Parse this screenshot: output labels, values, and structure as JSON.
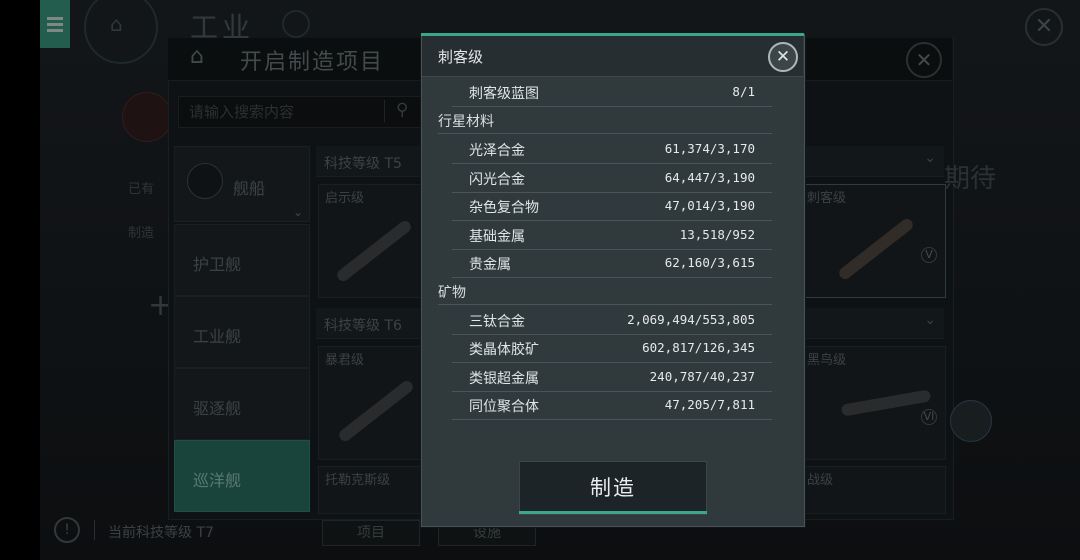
{
  "background": {
    "top_title": "工业",
    "side_labels": [
      "已有",
      "制造"
    ],
    "status_text": "当前科技等级 T7"
  },
  "mfg_dialog": {
    "title": "开启制造项目",
    "search_placeholder": "请输入搜索内容",
    "category_selected": "舰船",
    "categories": [
      "护卫舰",
      "工业舰",
      "驱逐舰",
      "巡洋舰"
    ],
    "tiers": [
      {
        "label": "科技等级 T5",
        "ships": [
          "启示级",
          "刺客级"
        ],
        "right_text": "期待"
      },
      {
        "label": "科技等级 T6",
        "ships": [
          "暴君级",
          "黑鸟级"
        ]
      },
      {
        "label": "",
        "ships": [
          "托勒克斯级",
          "战级"
        ]
      }
    ],
    "level_badges": [
      "V",
      "VI"
    ],
    "bottom_tabs": [
      "项目",
      "设施"
    ]
  },
  "popup": {
    "title": "刺客级",
    "blueprint": {
      "label": "刺客级蓝图",
      "value": "8/1"
    },
    "sections": [
      {
        "title": "行星材料",
        "items": [
          {
            "label": "光泽合金",
            "value": "61,374/3,170"
          },
          {
            "label": "闪光合金",
            "value": "64,447/3,190"
          },
          {
            "label": "杂色复合物",
            "value": "47,014/3,190"
          },
          {
            "label": "基础金属",
            "value": "13,518/952"
          },
          {
            "label": "贵金属",
            "value": "62,160/3,615"
          }
        ]
      },
      {
        "title": "矿物",
        "items": [
          {
            "label": "三钛合金",
            "value": "2,069,494/553,805"
          },
          {
            "label": "类晶体胶矿",
            "value": "602,817/126,345"
          },
          {
            "label": "类银超金属",
            "value": "240,787/40,237"
          },
          {
            "label": "同位聚合体",
            "value": "47,205/7,811"
          }
        ]
      }
    ],
    "craft_label": "制造"
  },
  "colors": {
    "accent": "#3ba88d",
    "popup_bg": "#30393c"
  }
}
